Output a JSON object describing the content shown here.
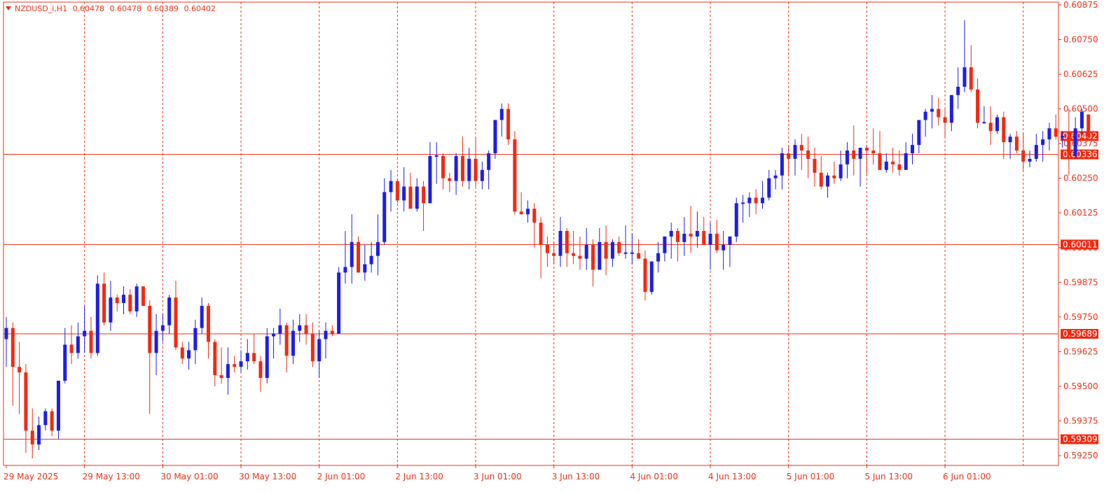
{
  "header": {
    "symbol": "NZDUSD_i,H1",
    "open": "0.60478",
    "high": "0.60478",
    "low": "0.60389",
    "close": "0.60402"
  },
  "colors": {
    "axis": "#e8341c",
    "grid": "#e8341c",
    "bull": "#1e1ee6",
    "bear": "#f22a12",
    "wick_bull": "#1e1ee6",
    "wick_bear": "#f22a12",
    "current": "#22cc22",
    "level_label_bg": "#f22a12",
    "level_label_text": "#ffffff"
  },
  "chart_data": {
    "type": "candlestick",
    "title": "NZDUSD_i,H1",
    "ylim": [
      0.5919,
      0.6089
    ],
    "y_ticks": [
      "0.60875",
      "0.60750",
      "0.60625",
      "0.60500",
      "0.60375",
      "0.60250",
      "0.60125",
      "0.60000",
      "0.59875",
      "0.59750",
      "0.59625",
      "0.59500",
      "0.59375",
      "0.59250"
    ],
    "x_ticks": [
      "29 May 2025",
      "29 May 13:00",
      "30 May 01:00",
      "30 May 13:00",
      "2 Jun 01:00",
      "2 Jun 13:00",
      "3 Jun 01:00",
      "3 Jun 13:00",
      "4 Jun 01:00",
      "4 Jun 13:00",
      "5 Jun 01:00",
      "5 Jun 13:00",
      "6 Jun 01:00"
    ],
    "x_tick_index": [
      0,
      12,
      24,
      36,
      48,
      60,
      72,
      84,
      96,
      108,
      120,
      132,
      144
    ],
    "horizontal_levels": [
      {
        "value": 0.60336,
        "label": "0.60336"
      },
      {
        "value": 0.60011,
        "label": "0.60011"
      },
      {
        "value": 0.59689,
        "label": "0.59689"
      },
      {
        "value": 0.59309,
        "label": "0.59309"
      }
    ],
    "current_price": {
      "value": 0.60402,
      "label": "0.60402"
    },
    "grid": "vertical dotted",
    "ohlc": [
      [
        0.5967,
        0.5975,
        0.5957,
        0.5971
      ],
      [
        0.5971,
        0.5973,
        0.5943,
        0.5957
      ],
      [
        0.5957,
        0.5966,
        0.594,
        0.5955
      ],
      [
        0.5955,
        0.5958,
        0.5926,
        0.5934
      ],
      [
        0.5934,
        0.5942,
        0.5924,
        0.5929
      ],
      [
        0.5929,
        0.5939,
        0.5927,
        0.5936
      ],
      [
        0.5936,
        0.5942,
        0.5934,
        0.5941
      ],
      [
        0.5941,
        0.5942,
        0.5932,
        0.5934
      ],
      [
        0.5934,
        0.5951,
        0.5931,
        0.5952
      ],
      [
        0.5952,
        0.5971,
        0.5951,
        0.5965
      ],
      [
        0.5965,
        0.5972,
        0.5958,
        0.5962
      ],
      [
        0.5962,
        0.5973,
        0.596,
        0.5968
      ],
      [
        0.5968,
        0.5979,
        0.5962,
        0.597
      ],
      [
        0.597,
        0.5975,
        0.596,
        0.5962
      ],
      [
        0.5962,
        0.599,
        0.5961,
        0.5987
      ],
      [
        0.5987,
        0.5991,
        0.5972,
        0.5973
      ],
      [
        0.5973,
        0.5988,
        0.597,
        0.5982
      ],
      [
        0.5982,
        0.5983,
        0.5977,
        0.598
      ],
      [
        0.598,
        0.5986,
        0.5976,
        0.5983
      ],
      [
        0.5983,
        0.5985,
        0.5976,
        0.5977
      ],
      [
        0.5977,
        0.5987,
        0.5975,
        0.5986
      ],
      [
        0.5986,
        0.5986,
        0.5979,
        0.5979
      ],
      [
        0.5979,
        0.5981,
        0.594,
        0.5962
      ],
      [
        0.5962,
        0.5976,
        0.5954,
        0.597
      ],
      [
        0.597,
        0.5976,
        0.5966,
        0.5972
      ],
      [
        0.5972,
        0.5983,
        0.5969,
        0.5982
      ],
      [
        0.5982,
        0.5988,
        0.5963,
        0.5964
      ],
      [
        0.5964,
        0.5966,
        0.5958,
        0.596
      ],
      [
        0.596,
        0.5966,
        0.5956,
        0.5963
      ],
      [
        0.5963,
        0.5974,
        0.5958,
        0.5971
      ],
      [
        0.5971,
        0.5982,
        0.5969,
        0.5979
      ],
      [
        0.5979,
        0.598,
        0.596,
        0.5966
      ],
      [
        0.5966,
        0.5967,
        0.595,
        0.5954
      ],
      [
        0.5954,
        0.5964,
        0.5951,
        0.5953
      ],
      [
        0.5953,
        0.5964,
        0.5947,
        0.5958
      ],
      [
        0.5958,
        0.5961,
        0.5955,
        0.5957
      ],
      [
        0.5957,
        0.5963,
        0.5955,
        0.5959
      ],
      [
        0.5959,
        0.5967,
        0.5956,
        0.5962
      ],
      [
        0.5962,
        0.5969,
        0.5958,
        0.5959
      ],
      [
        0.5959,
        0.5961,
        0.5948,
        0.5953
      ],
      [
        0.5953,
        0.5971,
        0.5951,
        0.5968
      ],
      [
        0.5968,
        0.5971,
        0.596,
        0.5969
      ],
      [
        0.5969,
        0.5978,
        0.5965,
        0.5972
      ],
      [
        0.5972,
        0.5973,
        0.5955,
        0.5961
      ],
      [
        0.5961,
        0.5974,
        0.5958,
        0.597
      ],
      [
        0.597,
        0.5976,
        0.5966,
        0.5972
      ],
      [
        0.5972,
        0.5976,
        0.5965,
        0.5969
      ],
      [
        0.5969,
        0.5973,
        0.5957,
        0.5959
      ],
      [
        0.5959,
        0.597,
        0.5953,
        0.5967
      ],
      [
        0.5967,
        0.5973,
        0.596,
        0.597
      ],
      [
        0.597,
        0.5972,
        0.5968,
        0.5969
      ],
      [
        0.5969,
        0.5993,
        0.5969,
        0.5991
      ],
      [
        0.5991,
        0.6006,
        0.5987,
        0.5993
      ],
      [
        0.5993,
        0.6012,
        0.5987,
        0.6002
      ],
      [
        0.6002,
        0.6004,
        0.5991,
        0.5991
      ],
      [
        0.5991,
        0.6001,
        0.5988,
        0.5994
      ],
      [
        0.5994,
        0.6002,
        0.5991,
        0.5997
      ],
      [
        0.5997,
        0.6012,
        0.599,
        0.6002
      ],
      [
        0.6002,
        0.6025,
        0.6001,
        0.602
      ],
      [
        0.602,
        0.6028,
        0.6013,
        0.6024
      ],
      [
        0.6024,
        0.6025,
        0.6016,
        0.6017
      ],
      [
        0.6017,
        0.6029,
        0.6013,
        0.6022
      ],
      [
        0.6022,
        0.6027,
        0.6015,
        0.6014
      ],
      [
        0.6014,
        0.6025,
        0.6013,
        0.6022
      ],
      [
        0.6022,
        0.6024,
        0.6006,
        0.6016
      ],
      [
        0.6016,
        0.6038,
        0.6016,
        0.6033
      ],
      [
        0.6033,
        0.6038,
        0.6023,
        0.6033
      ],
      [
        0.6033,
        0.6034,
        0.6021,
        0.6025
      ],
      [
        0.6025,
        0.6027,
        0.602,
        0.6024
      ],
      [
        0.6024,
        0.6034,
        0.6019,
        0.6033
      ],
      [
        0.6033,
        0.604,
        0.6022,
        0.6024
      ],
      [
        0.6024,
        0.6036,
        0.6021,
        0.6032
      ],
      [
        0.6032,
        0.604,
        0.6022,
        0.6024
      ],
      [
        0.6024,
        0.6031,
        0.6021,
        0.6028
      ],
      [
        0.6028,
        0.6035,
        0.6021,
        0.6034
      ],
      [
        0.6034,
        0.6046,
        0.6032,
        0.6046
      ],
      [
        0.6046,
        0.6052,
        0.604,
        0.605
      ],
      [
        0.605,
        0.6052,
        0.6037,
        0.6039
      ],
      [
        0.6039,
        0.6042,
        0.6012,
        0.6013
      ],
      [
        0.6013,
        0.602,
        0.6012,
        0.6012
      ],
      [
        0.6012,
        0.6017,
        0.6009,
        0.6014
      ],
      [
        0.6014,
        0.6016,
        0.6,
        0.6009
      ],
      [
        0.6009,
        0.6011,
        0.5989,
        0.6001
      ],
      [
        0.6001,
        0.6004,
        0.5993,
        0.5998
      ],
      [
        0.5998,
        0.6002,
        0.5994,
        0.5997
      ],
      [
        0.5997,
        0.6011,
        0.5993,
        0.6006
      ],
      [
        0.6006,
        0.6007,
        0.5993,
        0.5998
      ],
      [
        0.5998,
        0.6006,
        0.5994,
        0.5997
      ],
      [
        0.5997,
        0.6004,
        0.5992,
        0.5996
      ],
      [
        0.5996,
        0.6007,
        0.5992,
        0.6001
      ],
      [
        0.6001,
        0.6003,
        0.5986,
        0.5992
      ],
      [
        0.5992,
        0.6007,
        0.5992,
        0.6002
      ],
      [
        0.6002,
        0.6008,
        0.599,
        0.5996
      ],
      [
        0.5996,
        0.6003,
        0.5993,
        0.6002
      ],
      [
        0.6002,
        0.6004,
        0.5997,
        0.5998
      ],
      [
        0.5998,
        0.6008,
        0.5996,
        0.5998
      ],
      [
        0.5998,
        0.6005,
        0.5994,
        0.5998
      ],
      [
        0.5998,
        0.6003,
        0.5996,
        0.5996
      ],
      [
        0.5996,
        0.5999,
        0.5981,
        0.5984
      ],
      [
        0.5984,
        0.5995,
        0.5983,
        0.5995
      ],
      [
        0.5995,
        0.6002,
        0.5991,
        0.5998
      ],
      [
        0.5998,
        0.6003,
        0.5995,
        0.6004
      ],
      [
        0.6004,
        0.6009,
        0.5996,
        0.6006
      ],
      [
        0.6006,
        0.6007,
        0.5995,
        0.6002
      ],
      [
        0.6002,
        0.6011,
        0.5997,
        0.6005
      ],
      [
        0.6005,
        0.6015,
        0.5998,
        0.6004
      ],
      [
        0.6004,
        0.6013,
        0.6,
        0.6006
      ],
      [
        0.6006,
        0.6011,
        0.6001,
        0.6001
      ],
      [
        0.6001,
        0.6009,
        0.5992,
        0.6005
      ],
      [
        0.6005,
        0.601,
        0.5998,
        0.5999
      ],
      [
        0.5999,
        0.6006,
        0.5992,
        0.6001
      ],
      [
        0.6001,
        0.6004,
        0.5993,
        0.6004
      ],
      [
        0.6004,
        0.6018,
        0.6002,
        0.6016
      ],
      [
        0.6016,
        0.6019,
        0.6009,
        0.6016
      ],
      [
        0.6016,
        0.602,
        0.6011,
        0.6018
      ],
      [
        0.6018,
        0.6021,
        0.6012,
        0.6016
      ],
      [
        0.6016,
        0.6024,
        0.6014,
        0.6018
      ],
      [
        0.6018,
        0.6028,
        0.6017,
        0.6025
      ],
      [
        0.6025,
        0.6028,
        0.6021,
        0.6026
      ],
      [
        0.6026,
        0.6036,
        0.6021,
        0.6034
      ],
      [
        0.6034,
        0.6037,
        0.6026,
        0.6032
      ],
      [
        0.6032,
        0.6039,
        0.6026,
        0.6037
      ],
      [
        0.6037,
        0.6041,
        0.6028,
        0.6035
      ],
      [
        0.6035,
        0.604,
        0.6025,
        0.6032
      ],
      [
        0.6032,
        0.6036,
        0.6022,
        0.6027
      ],
      [
        0.6027,
        0.6033,
        0.6021,
        0.6022
      ],
      [
        0.6022,
        0.6027,
        0.6018,
        0.6026
      ],
      [
        0.6026,
        0.6031,
        0.6023,
        0.6025
      ],
      [
        0.6025,
        0.6035,
        0.6024,
        0.603
      ],
      [
        0.603,
        0.6038,
        0.6025,
        0.6035
      ],
      [
        0.6035,
        0.6044,
        0.6026,
        0.6032
      ],
      [
        0.6032,
        0.6036,
        0.6022,
        0.6036
      ],
      [
        0.6036,
        0.6037,
        0.6026,
        0.6035
      ],
      [
        0.6035,
        0.6043,
        0.603,
        0.6034
      ],
      [
        0.6034,
        0.6042,
        0.6028,
        0.6028
      ],
      [
        0.6028,
        0.6034,
        0.6027,
        0.6031
      ],
      [
        0.6031,
        0.6036,
        0.6027,
        0.603
      ],
      [
        0.603,
        0.6035,
        0.6026,
        0.6028
      ],
      [
        0.6028,
        0.6038,
        0.6028,
        0.6034
      ],
      [
        0.6034,
        0.6041,
        0.603,
        0.6037
      ],
      [
        0.6037,
        0.6046,
        0.6034,
        0.6046
      ],
      [
        0.6046,
        0.605,
        0.604,
        0.6049
      ],
      [
        0.6049,
        0.6055,
        0.6043,
        0.605
      ],
      [
        0.605,
        0.6054,
        0.6044,
        0.6047
      ],
      [
        0.6047,
        0.605,
        0.604,
        0.6045
      ],
      [
        0.6045,
        0.6054,
        0.6042,
        0.6055
      ],
      [
        0.6055,
        0.6065,
        0.605,
        0.6058
      ],
      [
        0.6058,
        0.6082,
        0.6056,
        0.6065
      ],
      [
        0.6065,
        0.6073,
        0.6056,
        0.6057
      ],
      [
        0.6057,
        0.6061,
        0.6043,
        0.6045
      ],
      [
        0.6045,
        0.6051,
        0.6045,
        0.6045
      ],
      [
        0.6045,
        0.6051,
        0.6037,
        0.6042
      ],
      [
        0.6042,
        0.6048,
        0.6041,
        0.6047
      ],
      [
        0.6047,
        0.6049,
        0.6032,
        0.6038
      ],
      [
        0.6038,
        0.6041,
        0.6032,
        0.604
      ],
      [
        0.604,
        0.6042,
        0.6034,
        0.6035
      ],
      [
        0.6035,
        0.6041,
        0.6028,
        0.6031
      ],
      [
        0.6031,
        0.6035,
        0.6029,
        0.6032
      ],
      [
        0.6032,
        0.6041,
        0.6031,
        0.6037
      ],
      [
        0.6037,
        0.6042,
        0.6031,
        0.6039
      ],
      [
        0.6039,
        0.6045,
        0.6035,
        0.6043
      ],
      [
        0.6043,
        0.6048,
        0.6039,
        0.604
      ],
      [
        0.604,
        0.6042,
        0.6036,
        0.604
      ],
      [
        0.604,
        0.605,
        0.6026,
        0.6033
      ],
      [
        0.6033,
        0.6047,
        0.6032,
        0.6043
      ],
      [
        0.6043,
        0.605,
        0.6041,
        0.6049
      ],
      [
        0.6048,
        0.6048,
        0.6039,
        0.604
      ]
    ]
  }
}
